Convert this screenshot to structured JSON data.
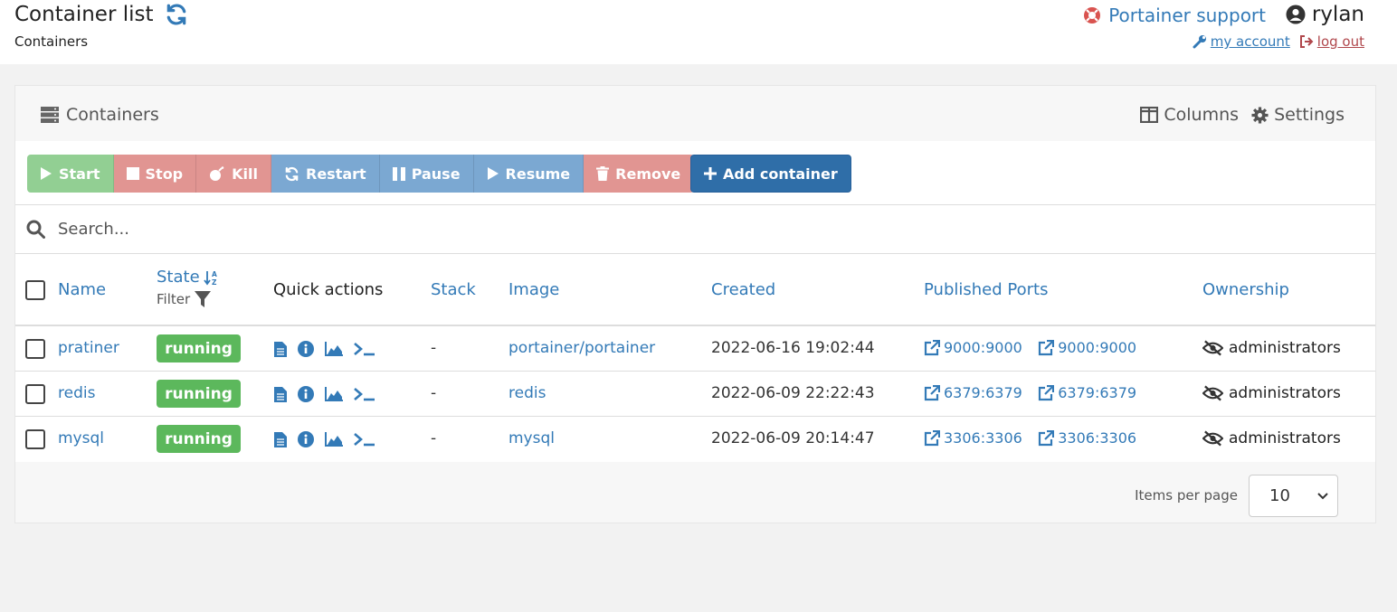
{
  "header": {
    "title": "Container list",
    "breadcrumb": "Containers",
    "support_label": "Portainer support",
    "username": "rylan",
    "my_account": "my account",
    "log_out": "log out"
  },
  "widget": {
    "title": "Containers",
    "columns_label": "Columns",
    "settings_label": "Settings"
  },
  "actions": {
    "start": "Start",
    "stop": "Stop",
    "kill": "Kill",
    "restart": "Restart",
    "pause": "Pause",
    "resume": "Resume",
    "remove": "Remove",
    "add_container": "Add container"
  },
  "search": {
    "placeholder": "Search..."
  },
  "table": {
    "columns": {
      "name": "Name",
      "state": "State",
      "filter": "Filter",
      "quick_actions": "Quick actions",
      "stack": "Stack",
      "image": "Image",
      "created": "Created",
      "ports": "Published Ports",
      "ownership": "Ownership"
    },
    "rows": [
      {
        "name": "pratiner",
        "state": "running",
        "stack": "-",
        "image": "portainer/portainer",
        "created": "2022-06-16 19:02:44",
        "ports": [
          "9000:9000",
          "9000:9000"
        ],
        "ownership": "administrators"
      },
      {
        "name": "redis",
        "state": "running",
        "stack": "-",
        "image": "redis",
        "created": "2022-06-09 22:22:43",
        "ports": [
          "6379:6379",
          "6379:6379"
        ],
        "ownership": "administrators"
      },
      {
        "name": "mysql",
        "state": "running",
        "stack": "-",
        "image": "mysql",
        "created": "2022-06-09 20:14:47",
        "ports": [
          "3306:3306",
          "3306:3306"
        ],
        "ownership": "administrators"
      }
    ]
  },
  "pagination": {
    "items_per_page_label": "Items per page",
    "items_per_page_value": "10"
  },
  "colors": {
    "link": "#337ab7",
    "running": "#5cb85c",
    "start": "#92cf93",
    "danger": "#e19592",
    "primary": "#7ba8d2",
    "add": "#2f6ea8"
  }
}
